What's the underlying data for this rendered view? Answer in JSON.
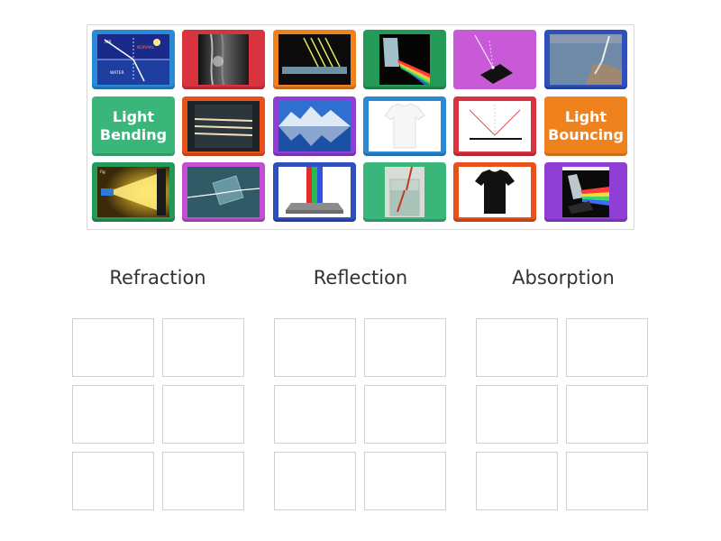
{
  "activity": {
    "tiles": [
      {
        "id": "t1",
        "kind": "image",
        "icon": "refraction-diagram-icon",
        "labels": [
          "AIR",
          "NORMAL",
          "WATER"
        ],
        "border": "#2a8ad6"
      },
      {
        "id": "t2",
        "kind": "image",
        "icon": "dark-curtain-photo-icon",
        "border": "#d9333f"
      },
      {
        "id": "t3",
        "kind": "image",
        "icon": "light-rays-on-block-icon",
        "border": "#f0821e"
      },
      {
        "id": "t4",
        "kind": "image",
        "icon": "prism-rainbow-icon",
        "border": "#249a58"
      },
      {
        "id": "t5",
        "kind": "image",
        "icon": "ray-on-mirror-icon",
        "border": "#c44fd4"
      },
      {
        "id": "t6",
        "kind": "image",
        "icon": "straw-in-water-photo-icon",
        "border": "#2f4fbf"
      },
      {
        "id": "t7",
        "kind": "text",
        "label": "Light Bending",
        "border": "#3ab67b"
      },
      {
        "id": "t8",
        "kind": "image",
        "icon": "light-beams-in-glass-icon",
        "border": "#e8521a"
      },
      {
        "id": "t9",
        "kind": "image",
        "icon": "mountain-lake-reflection-icon",
        "border": "#8f3fd6"
      },
      {
        "id": "t10",
        "kind": "image",
        "icon": "white-tshirt-icon",
        "border": "#2a8ad6"
      },
      {
        "id": "t11",
        "kind": "image",
        "icon": "reflection-angle-diagram-icon",
        "border": "#d9333f"
      },
      {
        "id": "t12",
        "kind": "text",
        "label": "Light Bouncing",
        "border": "#f0821e"
      },
      {
        "id": "t13",
        "kind": "image",
        "icon": "flashlight-beam-icon",
        "labels": [
          "fig"
        ],
        "border": "#249a58"
      },
      {
        "id": "t14",
        "kind": "image",
        "icon": "glass-slab-ray-icon",
        "border": "#c44fd4"
      },
      {
        "id": "t15",
        "kind": "image",
        "icon": "rgb-light-on-block-icon",
        "border": "#2f4fbf"
      },
      {
        "id": "t16",
        "kind": "image",
        "icon": "pencil-in-glass-icon",
        "border": "#3ab67b"
      },
      {
        "id": "t17",
        "kind": "image",
        "icon": "black-tshirt-icon",
        "border": "#e8521a"
      },
      {
        "id": "t18",
        "kind": "image",
        "icon": "prism-spectrum-icon",
        "border": "#8f3fd6"
      }
    ]
  },
  "categories": [
    {
      "title": "Refraction"
    },
    {
      "title": "Reflection"
    },
    {
      "title": "Absorption"
    }
  ]
}
